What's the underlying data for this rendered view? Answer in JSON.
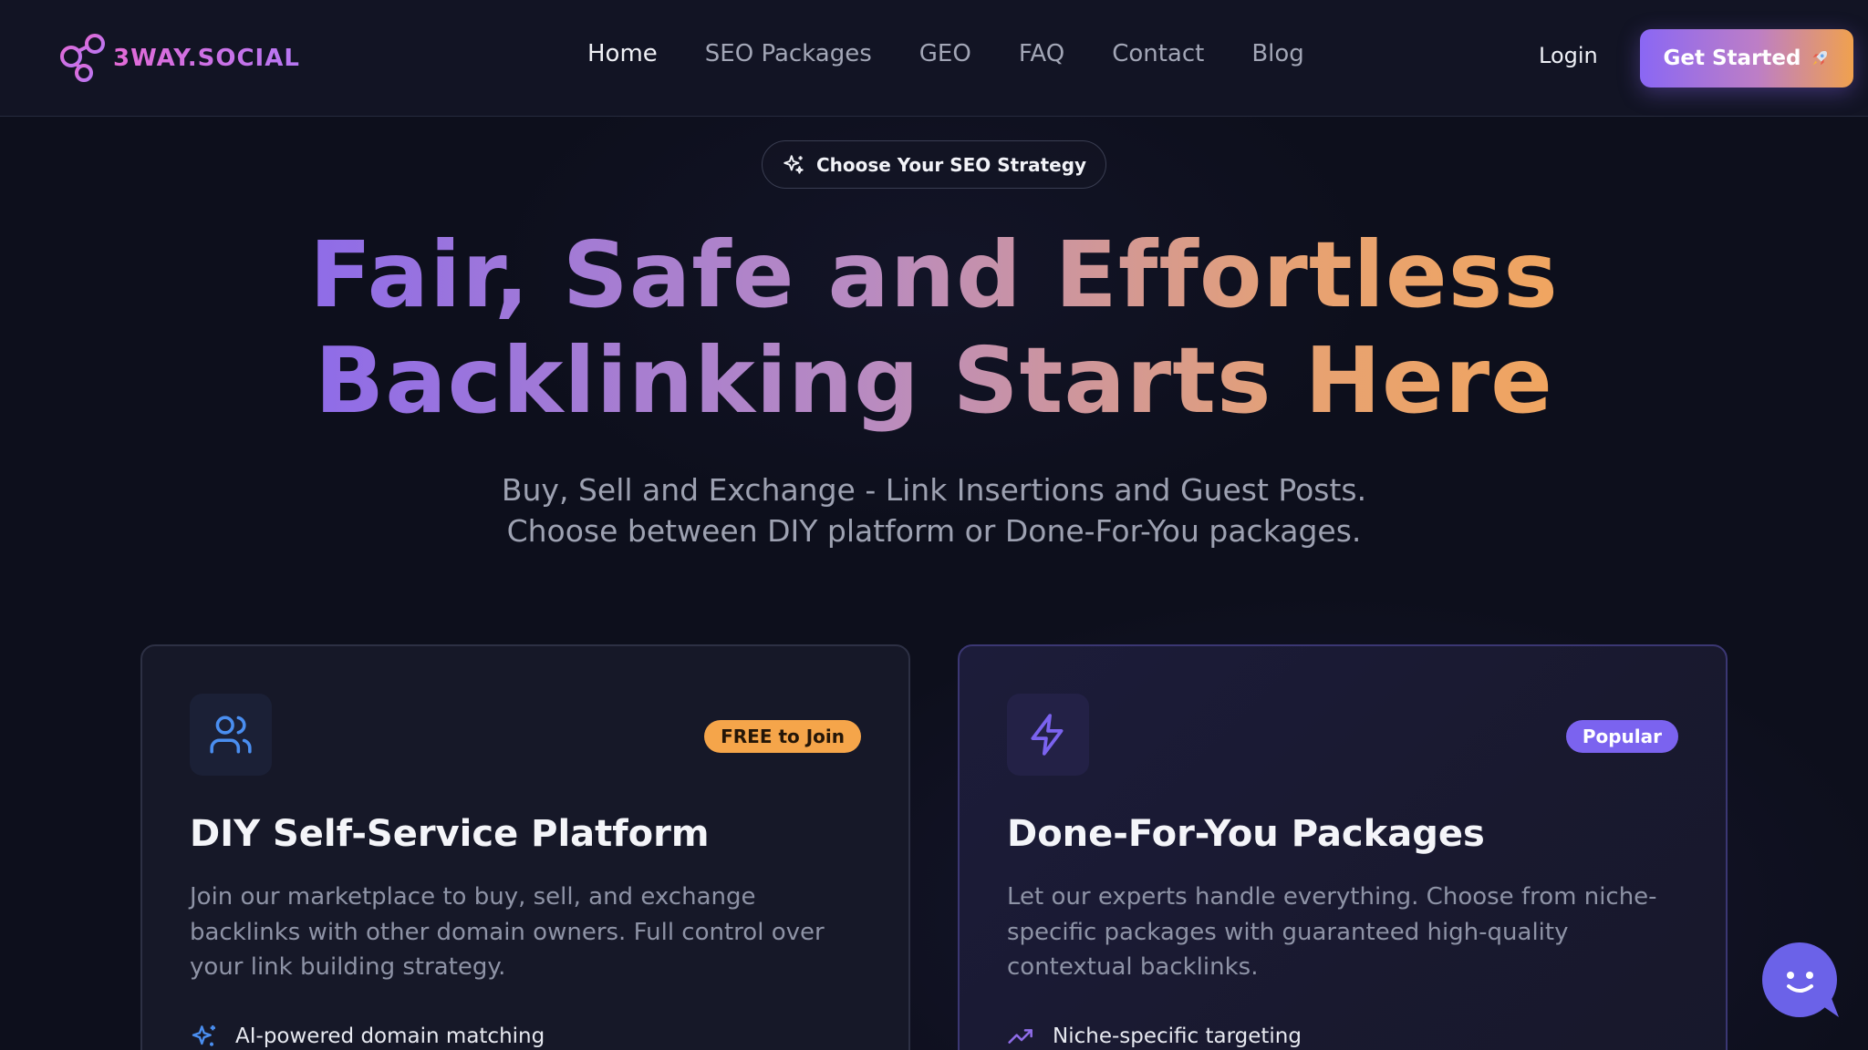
{
  "nav": {
    "brand": "3WAY.SOCIAL",
    "links": [
      {
        "label": "Home",
        "active": true
      },
      {
        "label": "SEO Packages",
        "active": false
      },
      {
        "label": "GEO",
        "active": false
      },
      {
        "label": "FAQ",
        "active": false
      },
      {
        "label": "Contact",
        "active": false
      },
      {
        "label": "Blog",
        "active": false
      }
    ],
    "login": "Login",
    "cta": "Get Started",
    "cta_icon": "rocket-icon"
  },
  "hero": {
    "pill": "Choose Your SEO Strategy",
    "pill_icon": "sparkles-icon",
    "headline_line1": "Fair, Safe and Effortless",
    "headline_line2": "Backlinking Starts Here",
    "subtitle_line1": "Buy, Sell and Exchange - Link Insertions and Guest Posts.",
    "subtitle_line2": "Choose between DIY platform or Done-For-You packages."
  },
  "cards": [
    {
      "icon": "users-icon",
      "badge": "FREE to Join",
      "title": "DIY Self-Service Platform",
      "description": "Join our marketplace to buy, sell, and exchange backlinks with other domain owners. Full control over your link building strategy.",
      "feature_icon": "sparkles-icon",
      "feature": "AI-powered domain matching"
    },
    {
      "icon": "lightning-icon",
      "badge": "Popular",
      "title": "Done-For-You Packages",
      "description": "Let our experts handle everything. Choose from niche-specific packages with guaranteed high-quality contextual backlinks.",
      "feature_icon": "trending-up-icon",
      "feature": "Niche-specific targeting"
    }
  ],
  "colors": {
    "background": "#0d0f1c",
    "accent_purple": "#8a67f4",
    "accent_orange": "#f0a14e",
    "badge_orange": "#f5a54a",
    "badge_purple": "#7b63ef"
  }
}
